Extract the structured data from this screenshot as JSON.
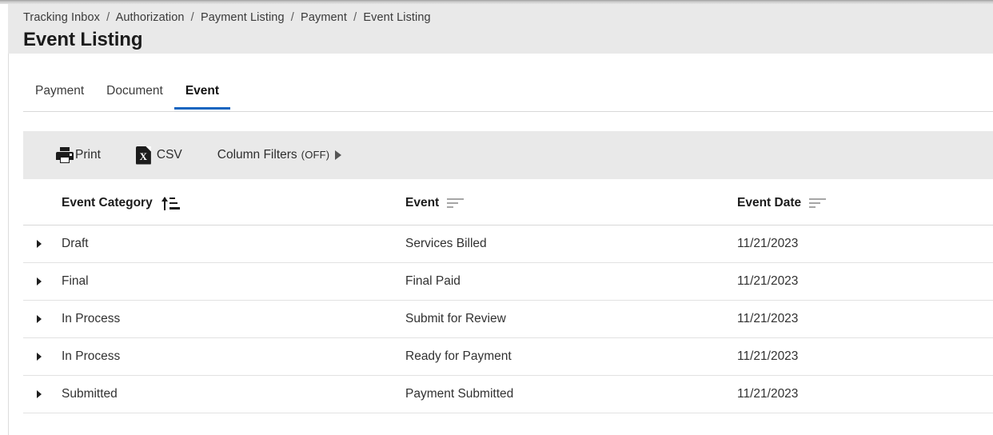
{
  "header": {
    "breadcrumb": [
      "Tracking Inbox",
      "Authorization",
      "Payment Listing",
      "Payment",
      "Event Listing"
    ],
    "breadcrumb_separator": "/",
    "title": "Event Listing"
  },
  "tabs": [
    {
      "label": "Payment",
      "active": false
    },
    {
      "label": "Document",
      "active": false
    },
    {
      "label": "Event",
      "active": true
    }
  ],
  "toolbar": {
    "print_label": "Print",
    "csv_label": "CSV",
    "csv_icon_letter": "X",
    "filters_label": "Column Filters",
    "filters_state": "(OFF)"
  },
  "table": {
    "columns": [
      {
        "label": "Event Category",
        "sort": "asc"
      },
      {
        "label": "Event",
        "sort": "none"
      },
      {
        "label": "Event Date",
        "sort": "none"
      }
    ],
    "rows": [
      {
        "category": "Draft",
        "event": "Services Billed",
        "date": "11/21/2023"
      },
      {
        "category": "Final",
        "event": "Final Paid",
        "date": "11/21/2023"
      },
      {
        "category": "In Process",
        "event": "Submit for Review",
        "date": "11/21/2023"
      },
      {
        "category": "In Process",
        "event": "Ready for Payment",
        "date": "11/21/2023"
      },
      {
        "category": "Submitted",
        "event": "Payment Submitted",
        "date": "11/21/2023"
      }
    ]
  },
  "colors": {
    "accent": "#1565c0",
    "header_band": "#e9e9e9",
    "toolbar_band": "#e9e9e9",
    "text": "#212529"
  }
}
